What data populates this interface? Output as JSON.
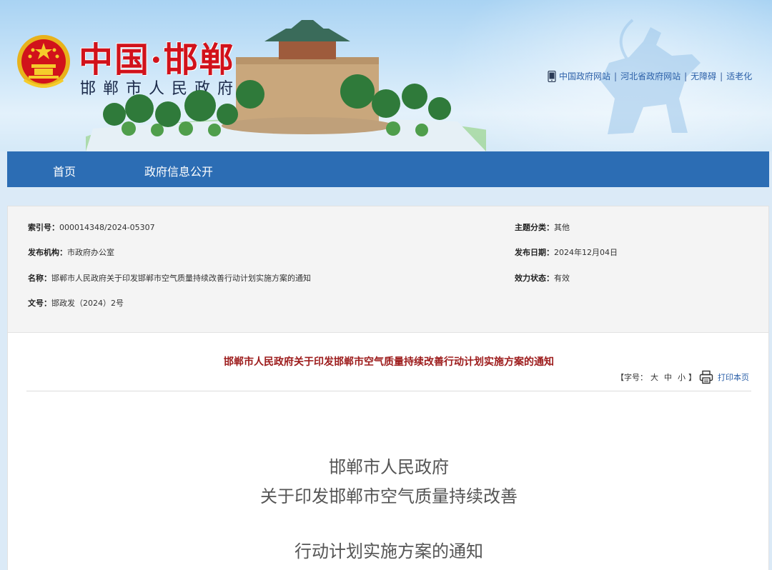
{
  "header": {
    "title_cn": "中国·邯郸",
    "subtitle": "邯郸市人民政府",
    "links": [
      "中国政府网站",
      "河北省政府网站",
      "无障碍",
      "适老化"
    ],
    "link_separators": [
      "|",
      "|",
      "|"
    ]
  },
  "nav": {
    "items": [
      {
        "label": "首页"
      },
      {
        "label": "政府信息公开"
      }
    ]
  },
  "info": {
    "index_key": "索引号：",
    "index_value": "000014348/2024-05307",
    "org_key": "发布机构：",
    "org_value": "市政府办公室",
    "name_key": "名称：",
    "name_value": "邯郸市人民政府关于印发邯郸市空气质量持续改善行动计划实施方案的通知",
    "docno_key": "文号：",
    "docno_value": "邯政发（2024）2号",
    "topic_key": "主题分类：",
    "topic_value": "其他",
    "date_key": "发布日期：",
    "date_value": "2024年12月04日",
    "status_key": "效力状态：",
    "status_value": "有效"
  },
  "article": {
    "title": "邯郸市人民政府关于印发邯郸市空气质量持续改善行动计划实施方案的通知",
    "font_size_label": "【字号：",
    "font_sizes": [
      "大",
      "中",
      "小"
    ],
    "font_size_close": "】",
    "print_label": "打印本页",
    "doc_lines": [
      "邯郸市人民政府",
      "关于印发邯郸市空气质量持续改善",
      "行动计划实施方案的通知"
    ]
  },
  "colors": {
    "nav_bg": "#2c6db4",
    "title_red": "#d1121b",
    "article_title": "#9c1a1a",
    "link_blue": "#2a5fa8"
  },
  "icons": {
    "emblem": "national-emblem-icon",
    "phone": "mobile-phone-icon",
    "print": "printer-icon"
  }
}
